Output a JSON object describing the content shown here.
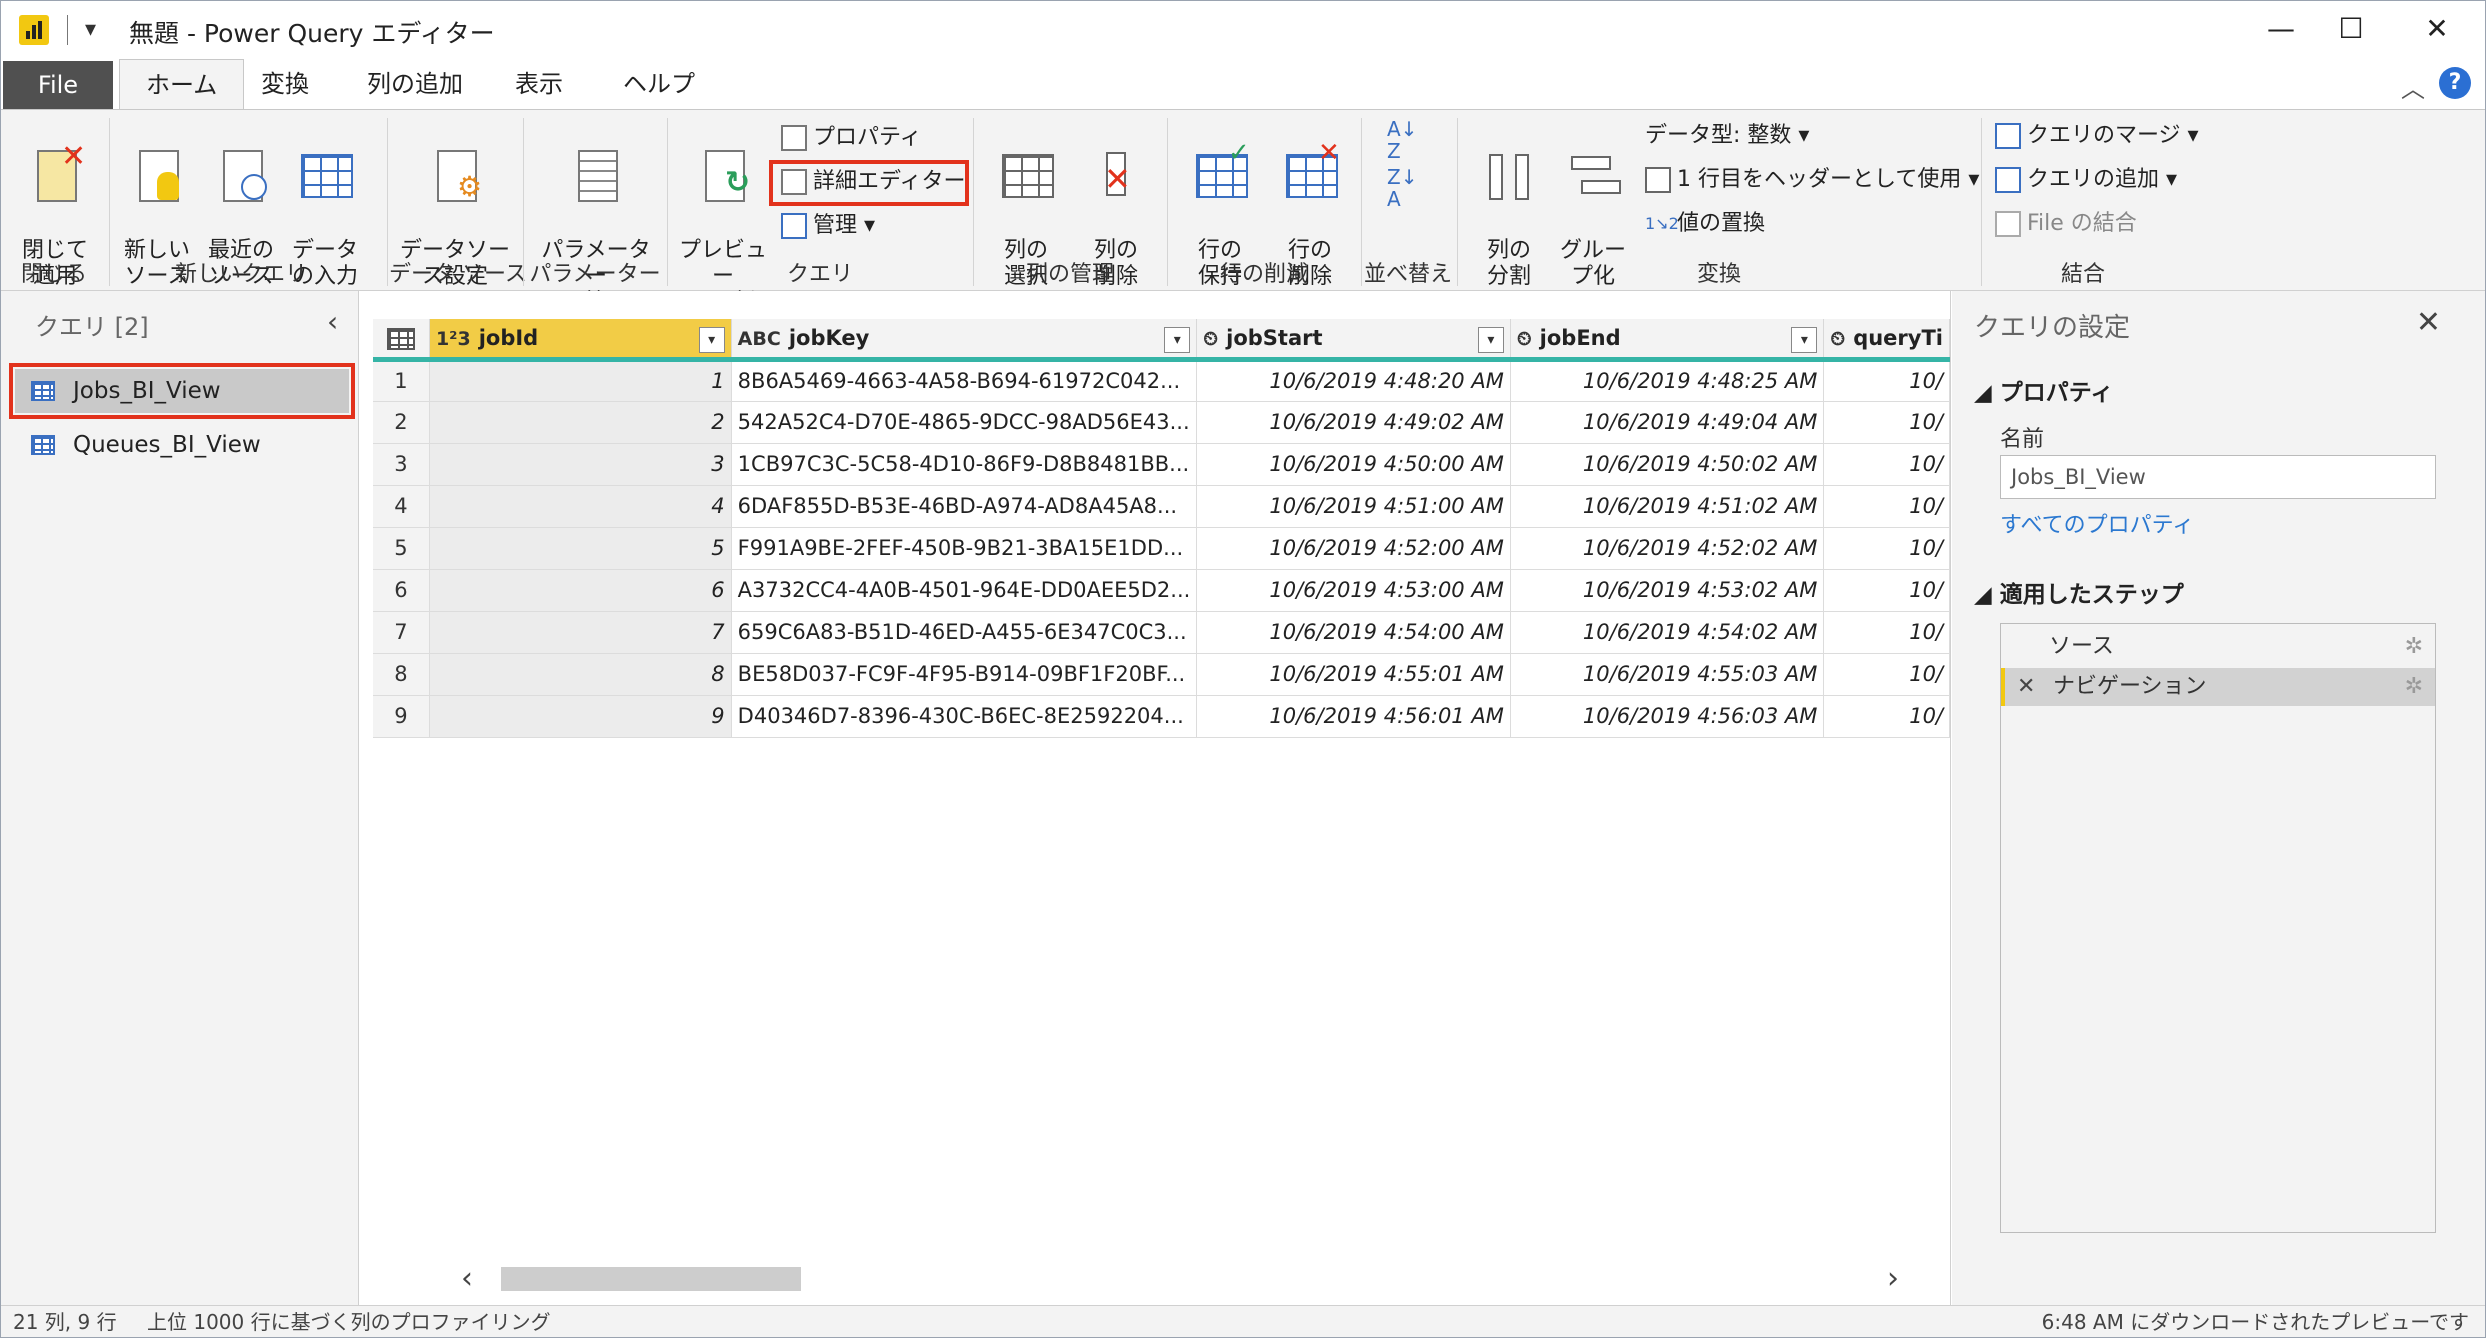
{
  "window": {
    "title": "無題 - Power Query エディター"
  },
  "tabs": [
    "File",
    "ホーム",
    "変換",
    "列の追加",
    "表示",
    "ヘルプ"
  ],
  "ribbon": {
    "close": {
      "btn": "閉じて\n適用",
      "group": "閉じる"
    },
    "new_query": {
      "new_source": "新しい\nソース",
      "recent_source": "最近の\nソース",
      "enter_data": "データ\nの入力",
      "group": "新しいクエリ"
    },
    "data_source": {
      "settings": "データソー\nス設定",
      "group": "データ ソース"
    },
    "parameters": {
      "manage": "パラメーター\nの管理",
      "group": "パラメーター"
    },
    "query": {
      "refresh": "プレビュー\nの更新",
      "properties": "プロパティ",
      "advanced_editor": "詳細エディター",
      "manage": "管理",
      "group": "クエリ"
    },
    "manage_columns": {
      "choose": "列の\n選択",
      "remove": "列の\n削除",
      "group": "列の管理"
    },
    "reduce_rows": {
      "keep": "行の\n保持",
      "remove": "行の\n削除",
      "group": "行の削減"
    },
    "sort": {
      "group": "並べ替え"
    },
    "transform": {
      "split": "列の\n分割",
      "group_by": "グルー\nプ化",
      "data_type": "データ型: 整数",
      "use_header": "1 行目をヘッダーとして使用",
      "replace": "値の置換",
      "group": "変換"
    },
    "combine": {
      "merge": "クエリのマージ",
      "append": "クエリの追加",
      "combine_files": "File の結合",
      "group": "結合"
    }
  },
  "left_pane": {
    "title": "クエリ [2]",
    "queries": [
      "Jobs_BI_View",
      "Queues_BI_View"
    ],
    "selected": "Jobs_BI_View"
  },
  "grid": {
    "columns": [
      {
        "type": "1²3",
        "name": "jobId"
      },
      {
        "type": "ABC",
        "name": "jobKey"
      },
      {
        "type": "⏲",
        "name": "jobStart"
      },
      {
        "type": "⏲",
        "name": "jobEnd"
      },
      {
        "type": "⏲",
        "name": "queryTi"
      }
    ],
    "rows": [
      [
        "1",
        "1",
        "8B6A5469-4663-4A58-B694-61972C042...",
        "10/6/2019 4:48:20 AM",
        "10/6/2019 4:48:25 AM",
        "10/"
      ],
      [
        "2",
        "2",
        "542A52C4-D70E-4865-9DCC-98AD56E43...",
        "10/6/2019 4:49:02 AM",
        "10/6/2019 4:49:04 AM",
        "10/"
      ],
      [
        "3",
        "3",
        "1CB97C3C-5C58-4D10-86F9-D8B8481BB...",
        "10/6/2019 4:50:00 AM",
        "10/6/2019 4:50:02 AM",
        "10/"
      ],
      [
        "4",
        "4",
        "6DAF855D-B53E-46BD-A974-AD8A45A8...",
        "10/6/2019 4:51:00 AM",
        "10/6/2019 4:51:02 AM",
        "10/"
      ],
      [
        "5",
        "5",
        "F991A9BE-2FEF-450B-9B21-3BA15E1DD...",
        "10/6/2019 4:52:00 AM",
        "10/6/2019 4:52:02 AM",
        "10/"
      ],
      [
        "6",
        "6",
        "A3732CC4-4A0B-4501-964E-DD0AEE5D2...",
        "10/6/2019 4:53:00 AM",
        "10/6/2019 4:53:02 AM",
        "10/"
      ],
      [
        "7",
        "7",
        "659C6A83-B51D-46ED-A455-6E347C0C3...",
        "10/6/2019 4:54:00 AM",
        "10/6/2019 4:54:02 AM",
        "10/"
      ],
      [
        "8",
        "8",
        "BE58D037-FC9F-4F95-B914-09BF1F20BF...",
        "10/6/2019 4:55:01 AM",
        "10/6/2019 4:55:03 AM",
        "10/"
      ],
      [
        "9",
        "9",
        "D40346D7-8396-430C-B6EC-8E2592204...",
        "10/6/2019 4:56:01 AM",
        "10/6/2019 4:56:03 AM",
        "10/"
      ]
    ]
  },
  "right_pane": {
    "title": "クエリの設定",
    "properties_header": "プロパティ",
    "name_label": "名前",
    "name_value": "Jobs_BI_View",
    "all_properties": "すべてのプロパティ",
    "steps_header": "適用したステップ",
    "steps": [
      "ソース",
      "ナビゲーション"
    ]
  },
  "status": {
    "left": "21 列, 9 行",
    "middle": "上位 1000 行に基づく列のプロファイリング",
    "right": "6:48 AM にダウンロードされたプレビューです"
  },
  "colors": {
    "accent": "#f2c811",
    "highlight": "#e2321c",
    "column_bar": "#35b4a6",
    "link": "#2b78d0"
  },
  "icons": [
    "minimize-icon",
    "maximize-icon",
    "close-icon",
    "chevron-up-icon",
    "help-icon",
    "gear-icon",
    "table-icon"
  ]
}
